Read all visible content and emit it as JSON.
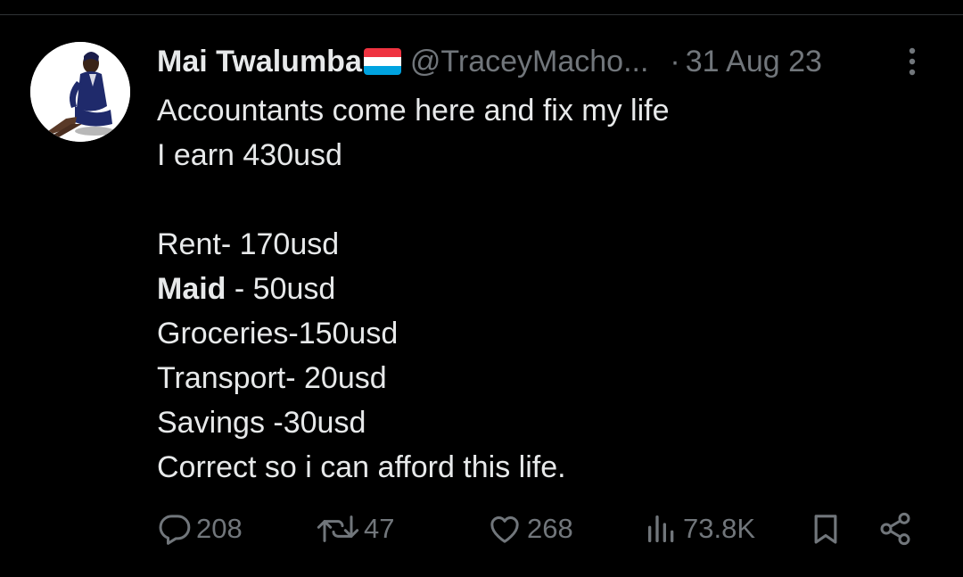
{
  "tweet": {
    "author": {
      "display_name": "Mai Twalumba",
      "handle": "@TraceyMacho...",
      "flag_icon": "luxembourg-flag-icon"
    },
    "separator": "·",
    "timestamp": "31 Aug 23",
    "body": {
      "line1": "Accountants come here and fix my life",
      "line2": "I earn 430usd",
      "line3": "",
      "line4": "Rent- 170usd",
      "line5_bold": "Maid",
      "line5_rest": " - 50usd",
      "line6": "Groceries-150usd",
      "line7": "Transport- 20usd",
      "line8": "Savings -30usd",
      "line9": "Correct so i can afford this life."
    },
    "actions": {
      "replies": "208",
      "reposts": "47",
      "likes": "268",
      "views": "73.8K"
    }
  },
  "colors": {
    "background": "#000000",
    "primary_text": "#e7e9ea",
    "secondary_text": "#71767b",
    "divider": "#2f3336"
  },
  "icons": {
    "more": "more-vertical-icon",
    "reply": "reply-icon",
    "repost": "repost-icon",
    "like": "heart-icon",
    "views": "views-chart-icon",
    "bookmark": "bookmark-icon",
    "share": "share-icon"
  }
}
